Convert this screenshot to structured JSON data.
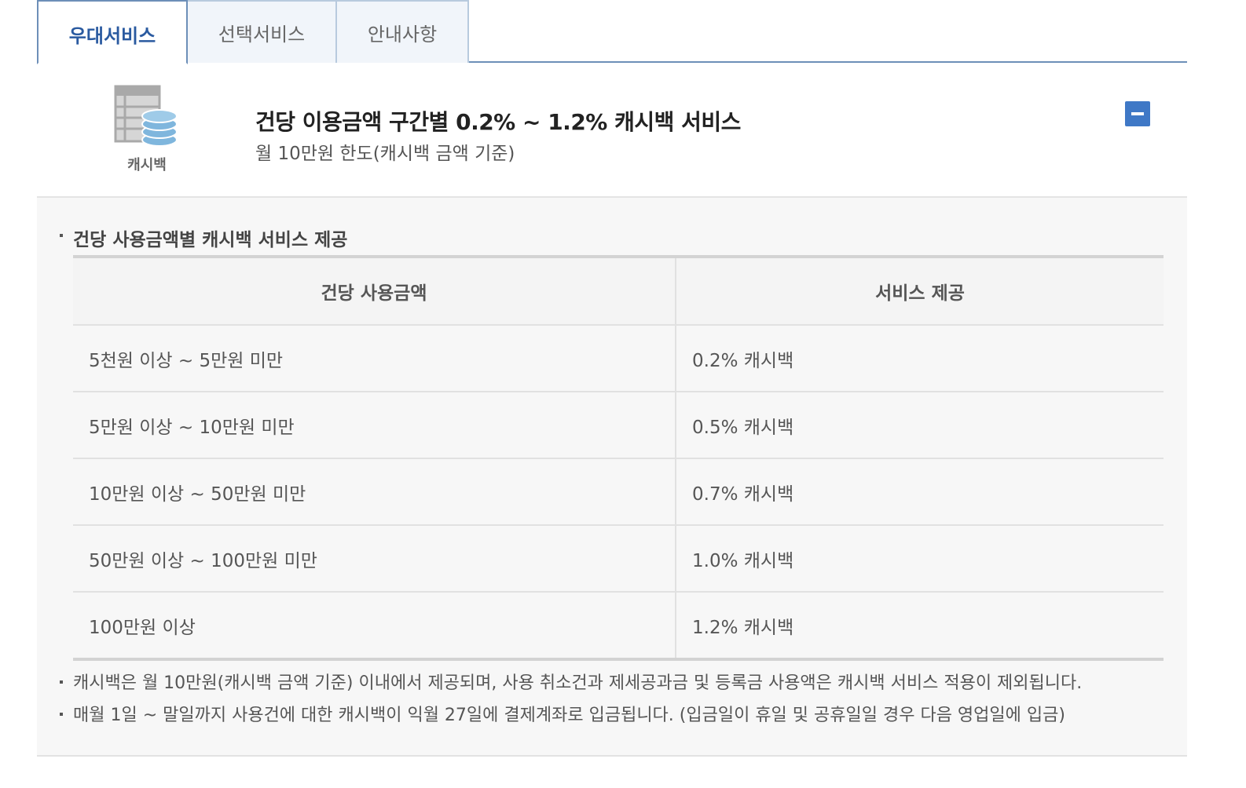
{
  "tabs": [
    {
      "label": "우대서비스",
      "active": true
    },
    {
      "label": "선택서비스",
      "active": false
    },
    {
      "label": "안내사항",
      "active": false
    }
  ],
  "service": {
    "icon": "cashback-icon",
    "icon_label": "캐시백",
    "title": "건당 이용금액 구간별 0.2% ~ 1.2% 캐시백 서비스",
    "subtitle": "월 10만원 한도(캐시백 금액 기준)"
  },
  "detail": {
    "section_title": "건당 사용금액별 캐시백 서비스 제공",
    "table": {
      "headers": [
        "건당 사용금액",
        "서비스 제공"
      ],
      "rows": [
        [
          "5천원 이상 ~ 5만원 미만",
          "0.2% 캐시백"
        ],
        [
          "5만원 이상 ~ 10만원 미만",
          "0.5% 캐시백"
        ],
        [
          "10만원 이상 ~ 50만원 미만",
          "0.7% 캐시백"
        ],
        [
          "50만원 이상 ~ 100만원 미만",
          "1.0% 캐시백"
        ],
        [
          "100만원 이상",
          "1.2% 캐시백"
        ]
      ]
    },
    "notes": [
      "캐시백은 월 10만원(캐시백 금액 기준) 이내에서 제공되며, 사용 취소건과 제세공과금 및 등록금 사용액은 캐시백 서비스 적용이 제외됩니다.",
      "매월 1일 ~ 말일까지 사용건에 대한 캐시백이 익월 27일에 결제계좌로 입금됩니다. (입금일이 휴일 및 공휴일일 경우 다음 영업일에 입금)"
    ]
  },
  "colors": {
    "accent": "#3f78c6",
    "tab_active_text": "#2a5aa0"
  }
}
